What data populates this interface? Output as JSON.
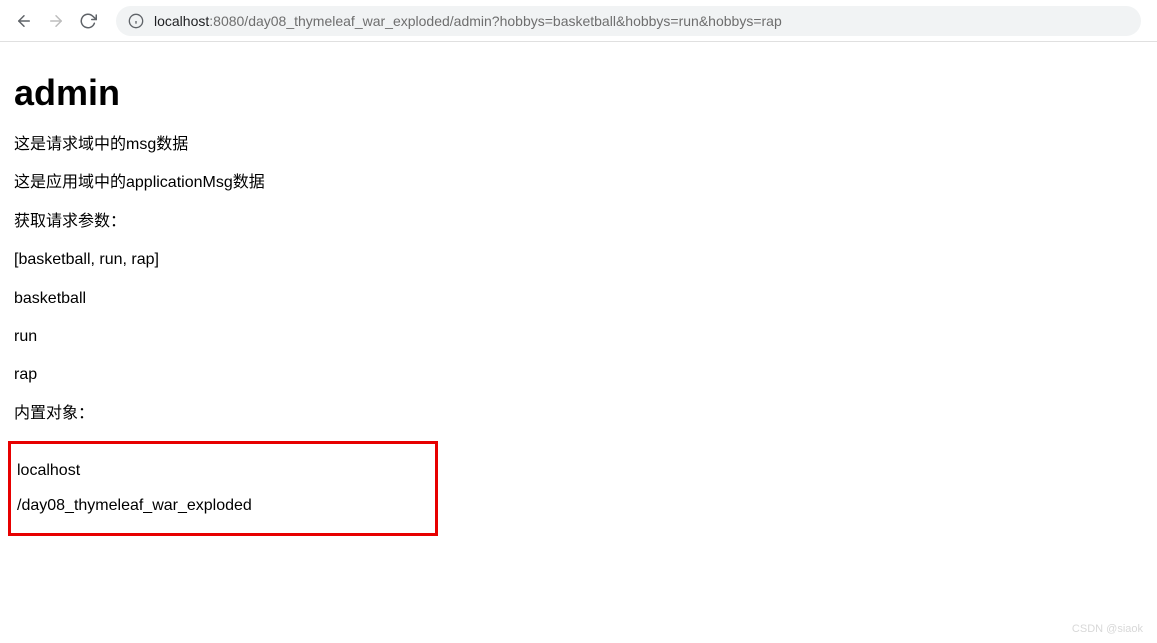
{
  "toolbar": {
    "url_host": "localhost",
    "url_port_path": ":8080/day08_thymeleaf_war_exploded/admin?hobbys=basketball&hobbys=run&hobbys=rap"
  },
  "page": {
    "heading": "admin",
    "msg_line": "这是请求域中的msg数据",
    "application_msg_line": "这是应用域中的applicationMsg数据",
    "get_params_label": "获取请求参数：",
    "params_array": "[basketball, run, rap]",
    "param1": "basketball",
    "param2": "run",
    "param3": "rap",
    "builtin_label": "内置对象：",
    "server_name": "localhost",
    "context_path": "/day08_thymeleaf_war_exploded"
  },
  "watermark": "CSDN @siaok"
}
